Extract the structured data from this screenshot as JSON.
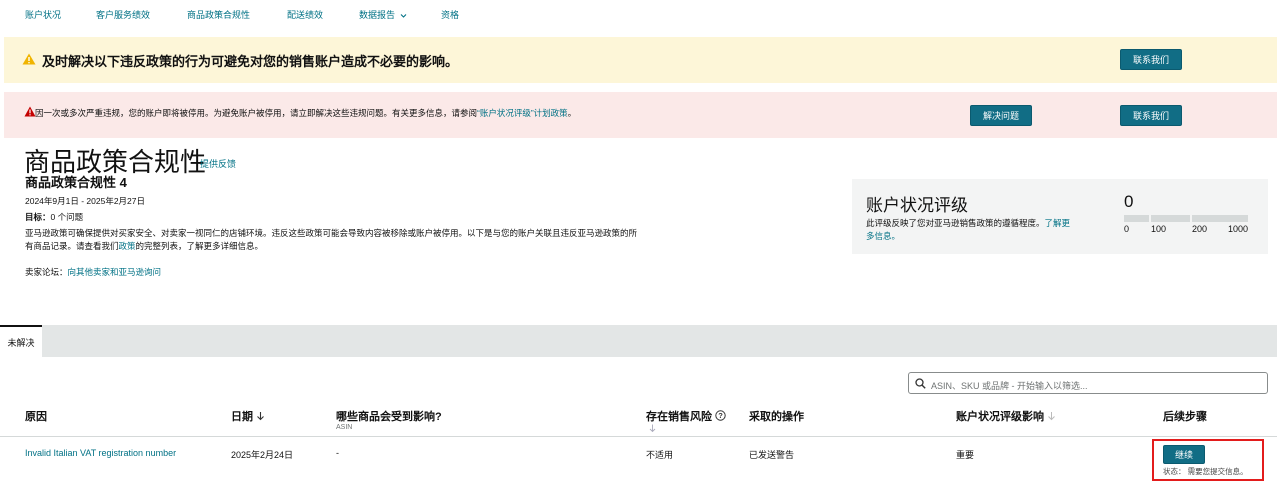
{
  "nav": {
    "items": [
      "账户状况",
      "客户服务绩效",
      "商品政策合规性",
      "配送绩效",
      "数据报告",
      "资格"
    ]
  },
  "alert_yellow": {
    "message": "及时解决以下违反政策的行为可避免对您的销售账户造成不必要的影响。",
    "contact_label": "联系我们"
  },
  "alert_red": {
    "message": "因一次或多次严重违规，您的账户即将被停用。为避免账户被停用，请立即解决这些违规问题。有关更多信息，请参阅",
    "link": "“账户状况评级”计划政策",
    "period": "。",
    "resolve_label": "解决问题",
    "contact_label": "联系我们"
  },
  "header": {
    "title": "商品政策合规性",
    "feedback": "提供反馈",
    "subtitle": "商品政策合规性 4",
    "date_range": "2024年9月1日 - 2025年2月27日",
    "target_label": "目标：",
    "target_value": "0 个问题",
    "description_pre": "亚马逊政策可确保提供对买家安全、对卖家一视同仁的店铺环境。违反这些政策可能会导致内容被移除或账户被停用。以下是与您的账户关联且违反亚马逊政策的所有商品记录。请查看我们",
    "description_link": "政策",
    "description_post": "的完整列表，了解更多详细信息。",
    "forum_label": "卖家论坛：",
    "forum_link": "向其他卖家和亚马逊询问"
  },
  "health_card": {
    "title": "账户状况评级",
    "desc": "此评级反映了您对亚马逊销售政策的遵循程度。",
    "learn_more": "了解更多信息。",
    "value": "0",
    "ticks": [
      "0",
      "100",
      "200",
      "1000"
    ]
  },
  "tabs": {
    "active": "未解决"
  },
  "search": {
    "placeholder": "ASIN、SKU 或品牌 - 开始输入以筛选..."
  },
  "table": {
    "headers": {
      "reason": "原因",
      "date": "日期",
      "affected": "哪些商品会受到影响?",
      "affected_sub": "ASIN",
      "risk": "存在销售风险",
      "action": "采取的操作",
      "impact": "账户状况评级影响",
      "next": "后续步骤"
    },
    "rows": [
      {
        "reason": "Invalid Italian VAT registration number",
        "date": "2025年2月24日",
        "asin": "-",
        "risk": "不适用",
        "action": "已发送警告",
        "impact": "重要",
        "next_button": "继续",
        "status": "状态：  需要您提交信息。"
      }
    ]
  },
  "colors": {
    "accent": "#116d85",
    "link": "#007185",
    "warning_bg": "#fdf6d8",
    "error_bg": "#fbe9e8",
    "highlight": "#e31c1c"
  }
}
